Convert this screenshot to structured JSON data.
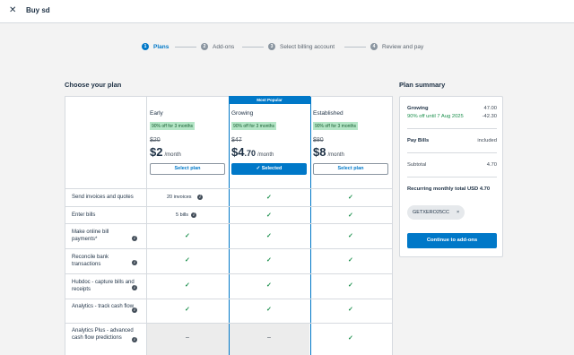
{
  "header": {
    "title": "Buy sd",
    "close_icon": "close-icon"
  },
  "stepper": [
    {
      "num": "1",
      "label": "Plans",
      "active": true
    },
    {
      "num": "2",
      "label": "Add-ons",
      "active": false
    },
    {
      "num": "3",
      "label": "Select billing account",
      "active": false
    },
    {
      "num": "4",
      "label": "Review and pay",
      "active": false
    }
  ],
  "choose_heading": "Choose your plan",
  "most_popular": "Most Popular",
  "plans": [
    {
      "name": "Early",
      "promo": "90% off for 3 months",
      "old_price": "$20",
      "price": "$2",
      "cents": "",
      "per": "/month",
      "button": "Select plan",
      "selected": false
    },
    {
      "name": "Growing",
      "promo": "90% off for 3 months",
      "old_price": "$47",
      "price": "$4",
      "cents": ".70",
      "per": "/month",
      "button": "✓  Selected",
      "selected": true
    },
    {
      "name": "Established",
      "promo": "90% off for 3 months",
      "old_price": "$80",
      "price": "$8",
      "cents": "",
      "per": "/month",
      "button": "Select plan",
      "selected": false
    }
  ],
  "features": [
    {
      "label": "Send invoices and quotes",
      "early": "20 invoices",
      "growing": "check",
      "established": "check",
      "info": true
    },
    {
      "label": "Enter bills",
      "early": "5 bills",
      "growing": "check",
      "established": "check",
      "info": true
    },
    {
      "label": "Make online bill payments*",
      "early": "check",
      "growing": "check",
      "established": "check",
      "info": true
    },
    {
      "label": "Reconcile bank transactions",
      "early": "check",
      "growing": "check",
      "established": "check",
      "info": true
    },
    {
      "label": "Hubdoc - capture bills and receipts",
      "early": "check",
      "growing": "check",
      "established": "check",
      "info": true
    },
    {
      "label": "Analytics - track cash flow",
      "early": "check",
      "growing": "check",
      "established": "check",
      "info": true
    },
    {
      "label": "Analytics Plus - advanced cash flow predictions",
      "early": "–",
      "growing": "–",
      "established": "check",
      "info": true
    }
  ],
  "summary": {
    "heading": "Plan summary",
    "plan_name": "Growing",
    "plan_price": "47.00",
    "discount_label": "90% off until 7 Aug 2025",
    "discount_value": "-42.30",
    "pay_bills_label": "Pay Bills",
    "pay_bills_value": "included",
    "subtotal_label": "Subtotal",
    "subtotal_value": "4.70",
    "recurring_label": "Recurring monthly total USD 4.70",
    "promo_code": "GETXERO25CC",
    "promo_remove": "×",
    "continue_button": "Continue to add-ons"
  },
  "colors": {
    "accent": "#0078c8",
    "promo_bg": "#b4e5c6",
    "check": "#1b8f4c",
    "discount_text": "#1b8f4c"
  }
}
